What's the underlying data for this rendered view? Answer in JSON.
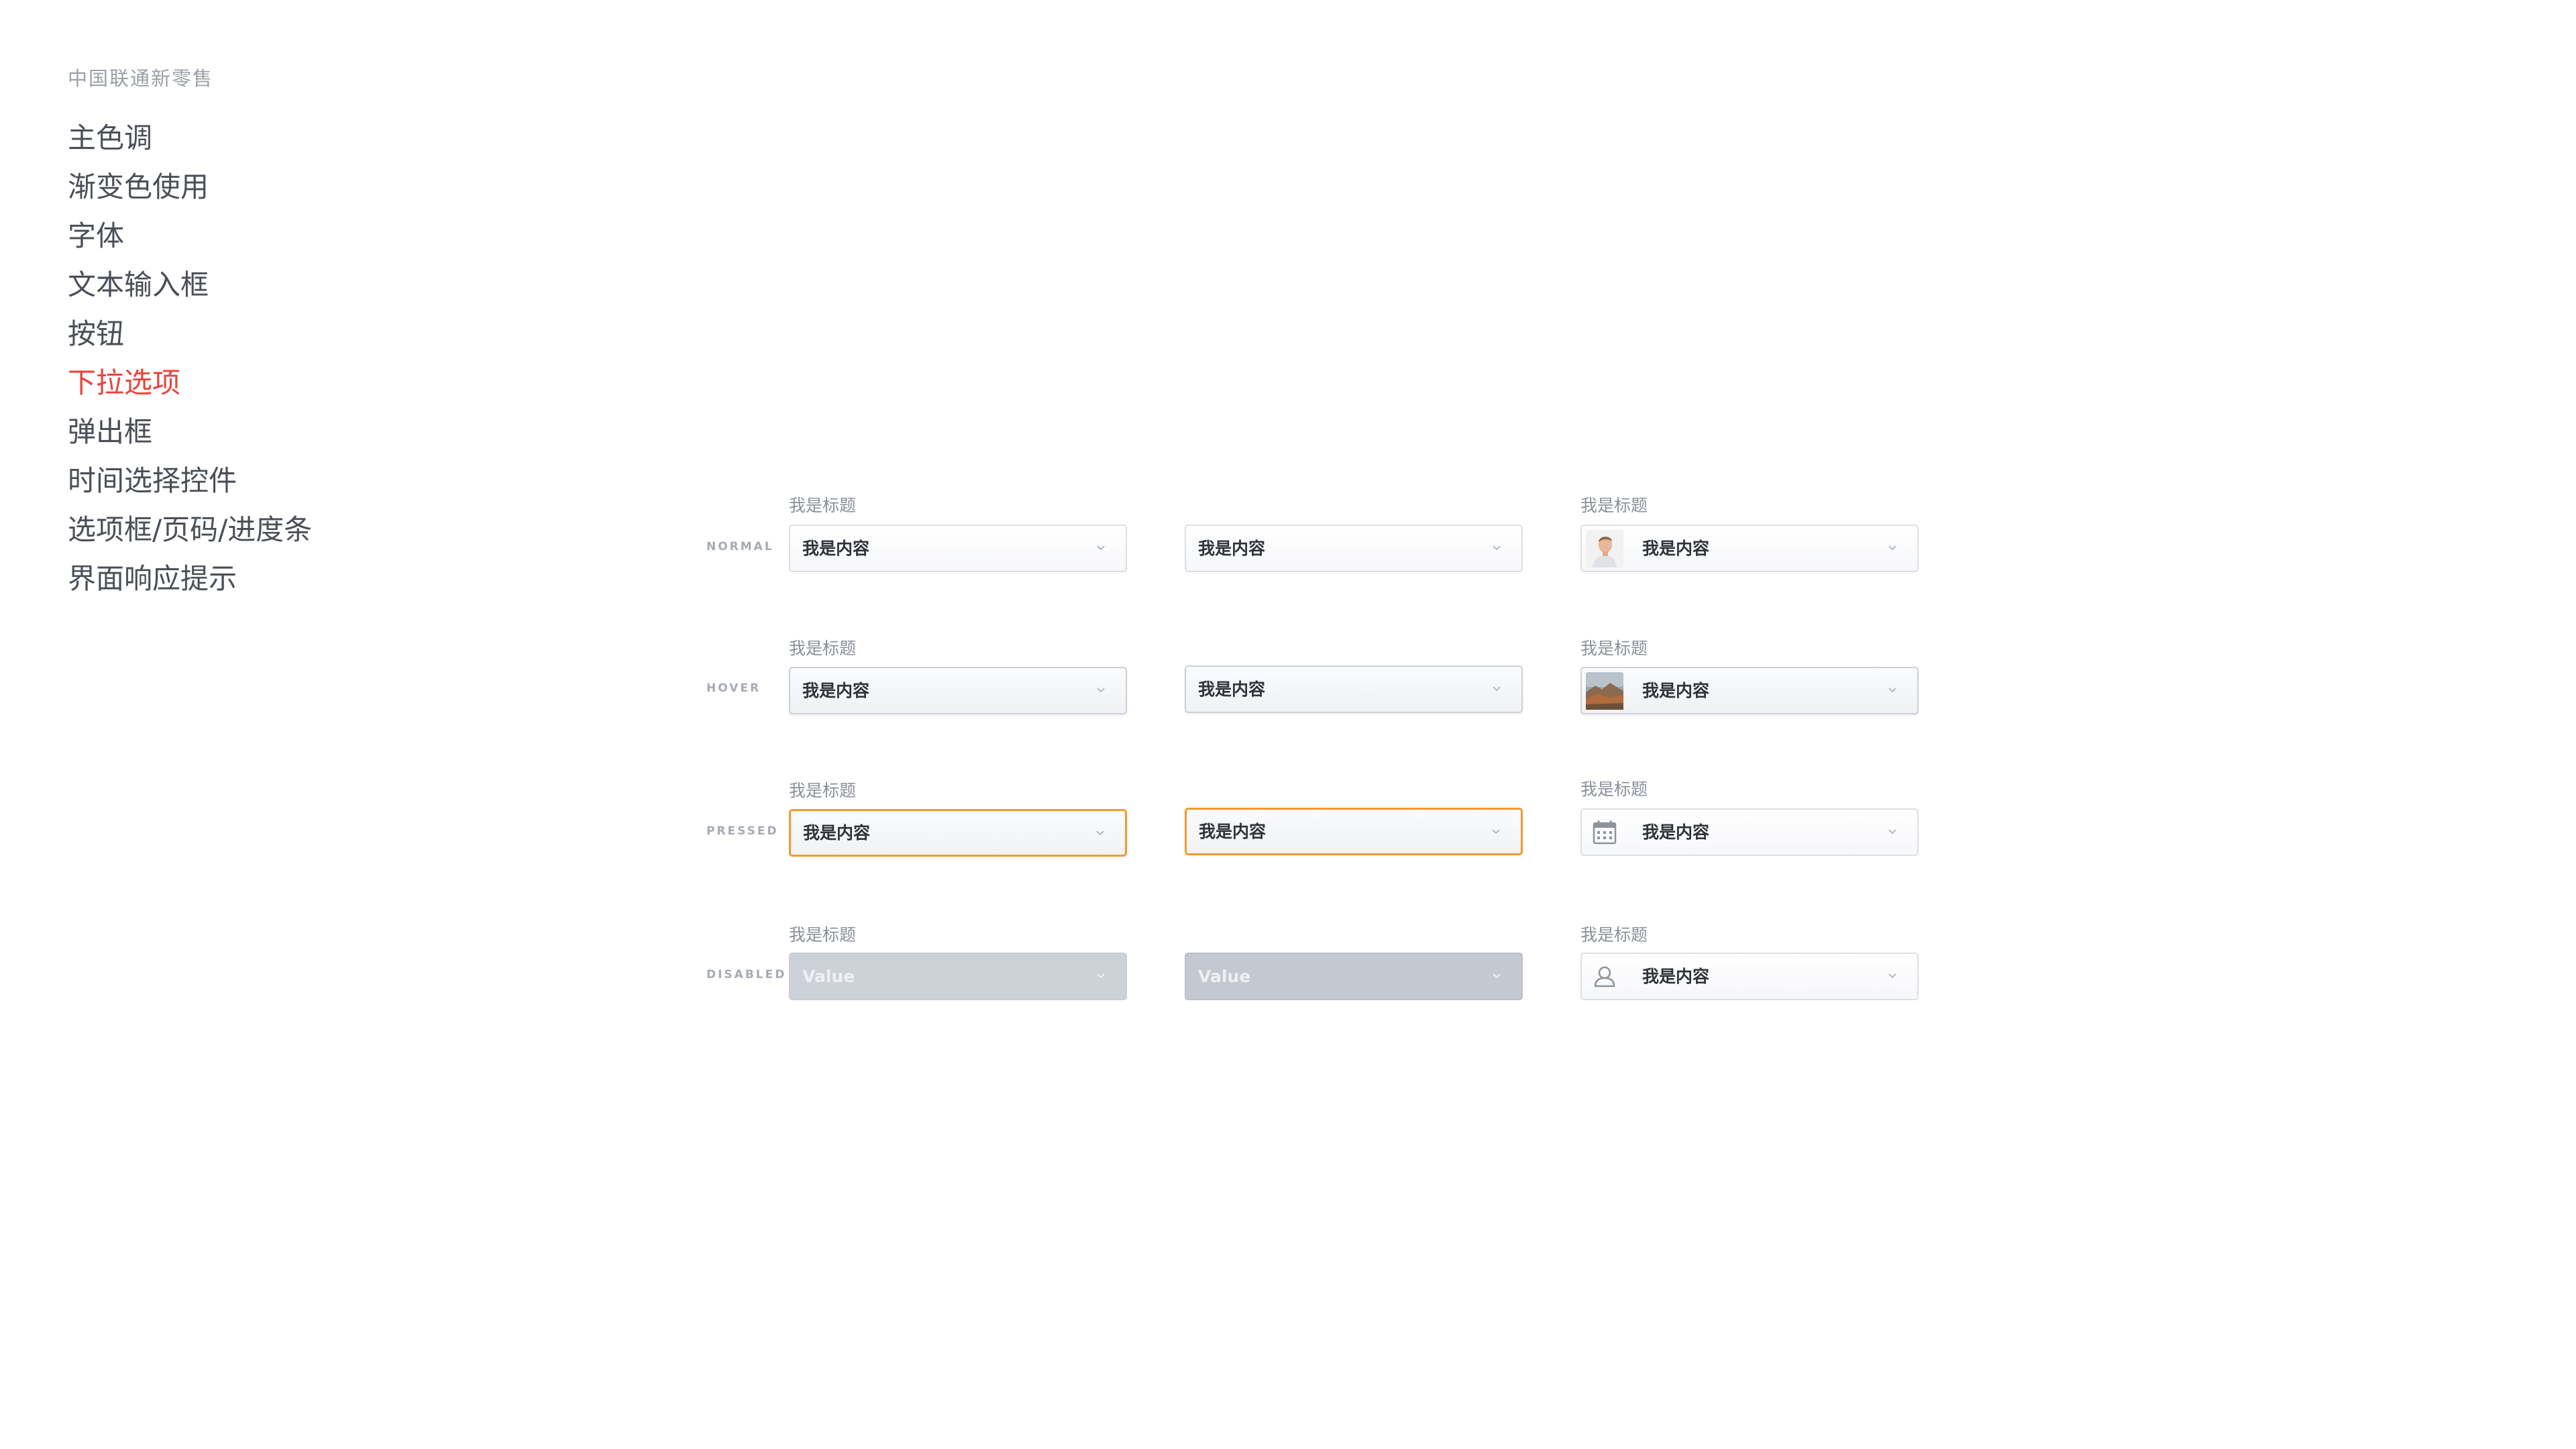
{
  "brand": "中国联通新零售",
  "nav": [
    "主色调",
    "渐变色使用",
    "字体",
    "文本输入框",
    "按钮",
    "下拉选项",
    "弹出框",
    "时间选择控件",
    "选项框/页码/进度条",
    "界面响应提示"
  ],
  "active_nav": "下拉选项",
  "states": {
    "normal": "NORMAL",
    "hover": "HOVER",
    "pressed": "PRESSED",
    "disabled": "DISABLED"
  },
  "field": {
    "title": "我是标题",
    "value": "我是内容",
    "disabled_value": "Value"
  },
  "icons": {
    "row1": "avatar-photo",
    "row2": "landscape-photo",
    "row3": "calendar-icon",
    "row4": "user-icon"
  },
  "colors": {
    "active_nav": "#e8443a",
    "pressed_border": "#f39a2c",
    "disabled_fill": "#cdd1d8"
  }
}
